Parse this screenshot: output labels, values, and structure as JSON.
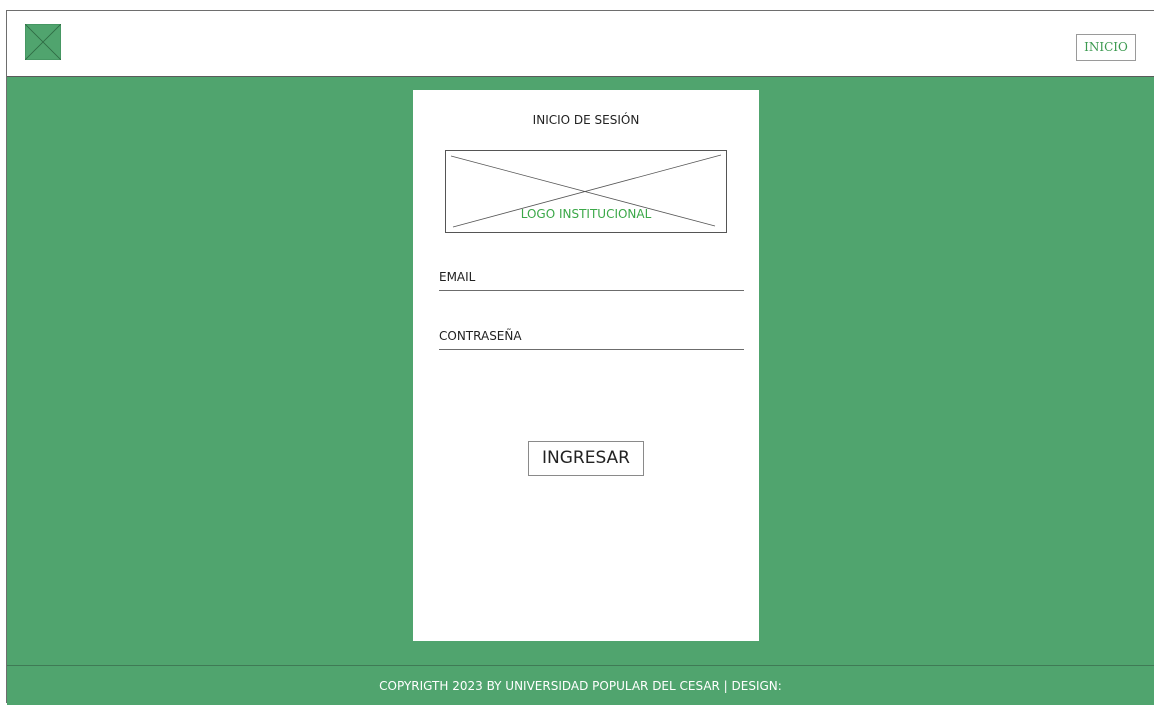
{
  "header": {
    "logo_icon": "image-placeholder-icon",
    "nav_inicio_label": "INICIO"
  },
  "login_card": {
    "title": "INICIO DE SESIÓN",
    "logo_caption": "LOGO INSTITUCIONAL",
    "email_label": "EMAIL",
    "password_label": "CONTRASEÑA",
    "submit_label": "INGRESAR"
  },
  "footer": {
    "text": "COPYRIGTH 2023 BY UNIVERSIDAD POPULAR DEL CESAR | DESIGN:"
  },
  "colors": {
    "background_green": "#50a46e",
    "accent_text_green": "#3ba848",
    "card_white": "#ffffff"
  }
}
